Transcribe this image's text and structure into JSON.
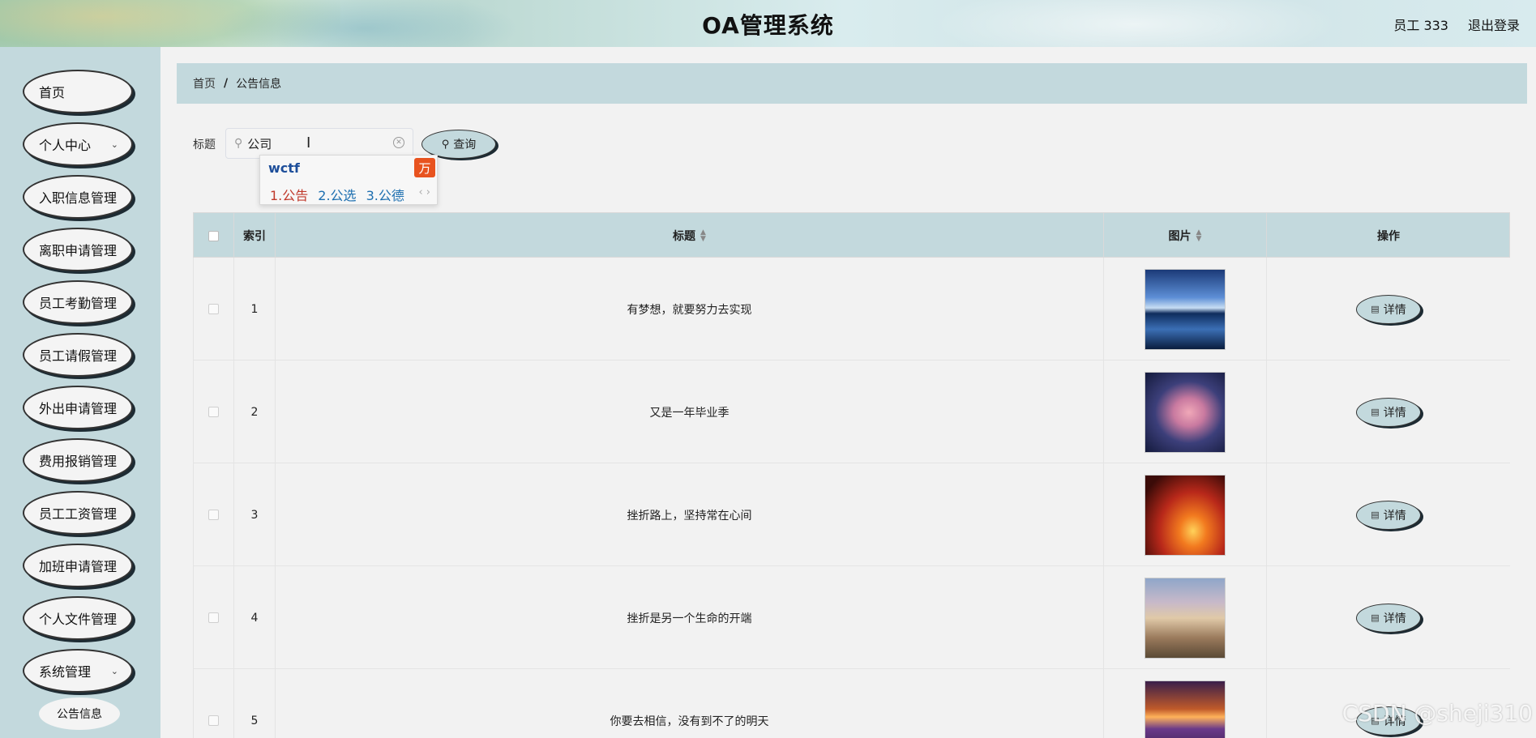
{
  "header": {
    "title": "OA管理系统",
    "user": "员工 333",
    "logout": "退出登录"
  },
  "sidebar": {
    "items": [
      {
        "label": "首页"
      },
      {
        "label": "个人中心"
      },
      {
        "label": "入职信息管理"
      },
      {
        "label": "离职申请管理"
      },
      {
        "label": "员工考勤管理"
      },
      {
        "label": "员工请假管理"
      },
      {
        "label": "外出申请管理"
      },
      {
        "label": "费用报销管理"
      },
      {
        "label": "员工工资管理"
      },
      {
        "label": "加班申请管理"
      },
      {
        "label": "个人文件管理"
      },
      {
        "label": "系统管理"
      }
    ],
    "sub_item": "公告信息"
  },
  "breadcrumb": {
    "home": "首页",
    "separator": "/",
    "current": "公告信息"
  },
  "search": {
    "label": "标题",
    "value": "公司",
    "button": "查询"
  },
  "ime": {
    "composition": "wctf",
    "candidates": [
      "1.公告",
      "2.公选",
      "3.公德"
    ],
    "pager": "‹ ›"
  },
  "table": {
    "headers": {
      "index": "索引",
      "title": "标题",
      "image": "图片",
      "action": "操作"
    },
    "rows": [
      {
        "index": "1",
        "title": "有梦想，就要努力去实现",
        "action": "详情"
      },
      {
        "index": "2",
        "title": "又是一年毕业季",
        "action": "详情"
      },
      {
        "index": "3",
        "title": "挫折路上，坚持常在心间",
        "action": "详情"
      },
      {
        "index": "4",
        "title": "挫折是另一个生命的开端",
        "action": "详情"
      },
      {
        "index": "5",
        "title": "你要去相信，没有到不了的明天",
        "action": "详情"
      }
    ]
  },
  "watermark": "CSDN @sheji310",
  "colors": {
    "accent": "#c3d9dd",
    "background": "#f2f2f2",
    "ime_logo": "#e8531f"
  }
}
